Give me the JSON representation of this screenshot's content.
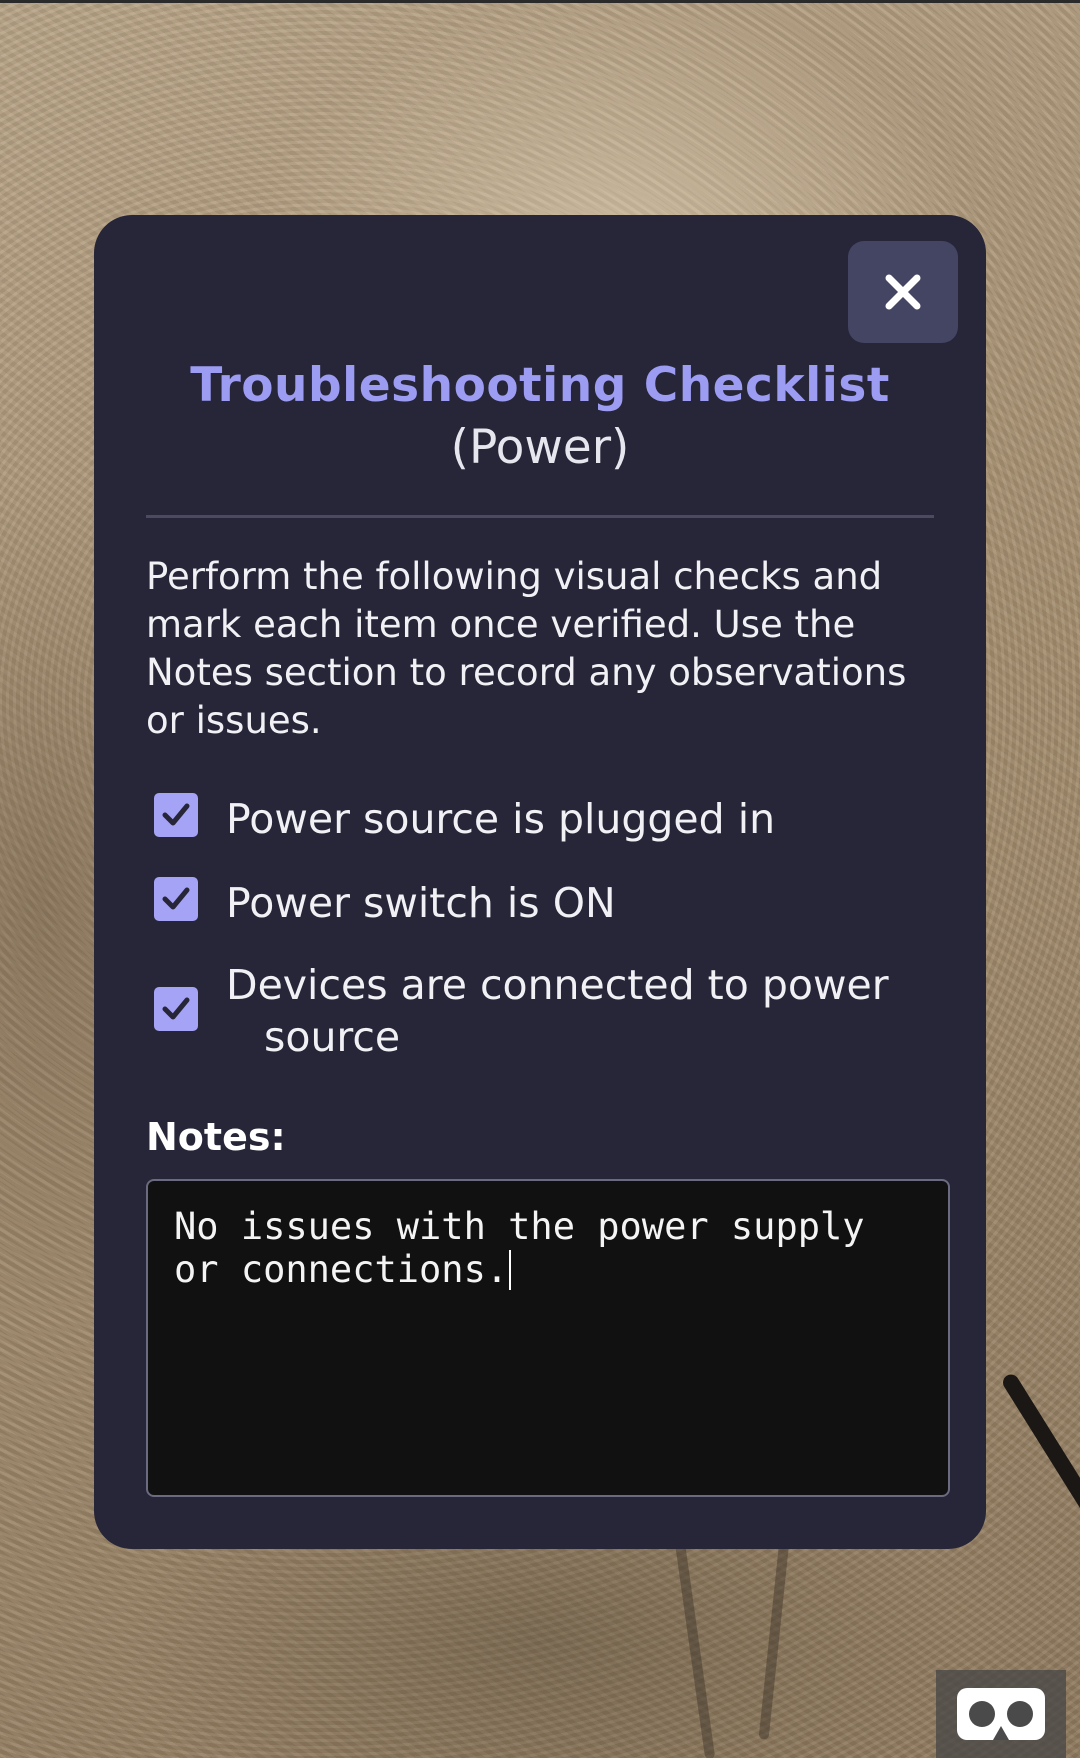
{
  "modal": {
    "title": "Troubleshooting Checklist",
    "subtitle": "(Power)",
    "instructions": "Perform the following visual checks and mark each item once verified. Use the Notes section to record any observations or issues.",
    "close_icon": "close-icon",
    "accent_color": "#9d9cf3",
    "background_color": "#262638"
  },
  "checklist": {
    "items": [
      {
        "label": "Power source is plugged in",
        "checked": true
      },
      {
        "label": "Power switch is ON",
        "checked": true
      },
      {
        "label_line1": "Devices are connected to power",
        "label_line2": "source",
        "checked": true
      }
    ]
  },
  "notes": {
    "label": "Notes:",
    "value": "No issues with the power supply\nor connections."
  },
  "vr_button": {
    "icon": "vr-headset-icon"
  }
}
